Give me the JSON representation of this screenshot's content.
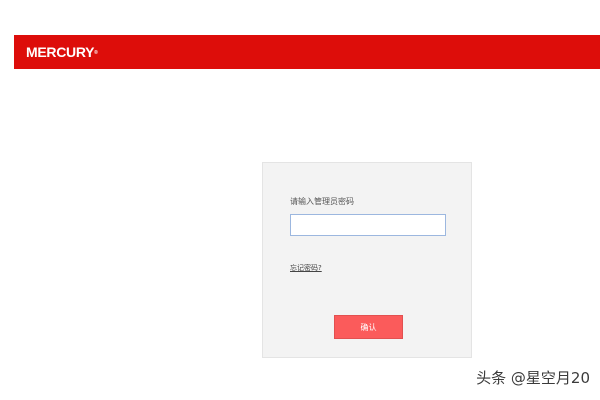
{
  "header": {
    "brand": "MERCURY",
    "brand_mark": "®",
    "background_color": "#dd0d0a"
  },
  "login": {
    "prompt_label": "请输入管理员密码",
    "password_value": "",
    "forgot_password_label": "忘记密码?",
    "confirm_label": "确认",
    "confirm_color": "#fb5b5b"
  },
  "watermark": {
    "text": "头条 @星空月20"
  }
}
